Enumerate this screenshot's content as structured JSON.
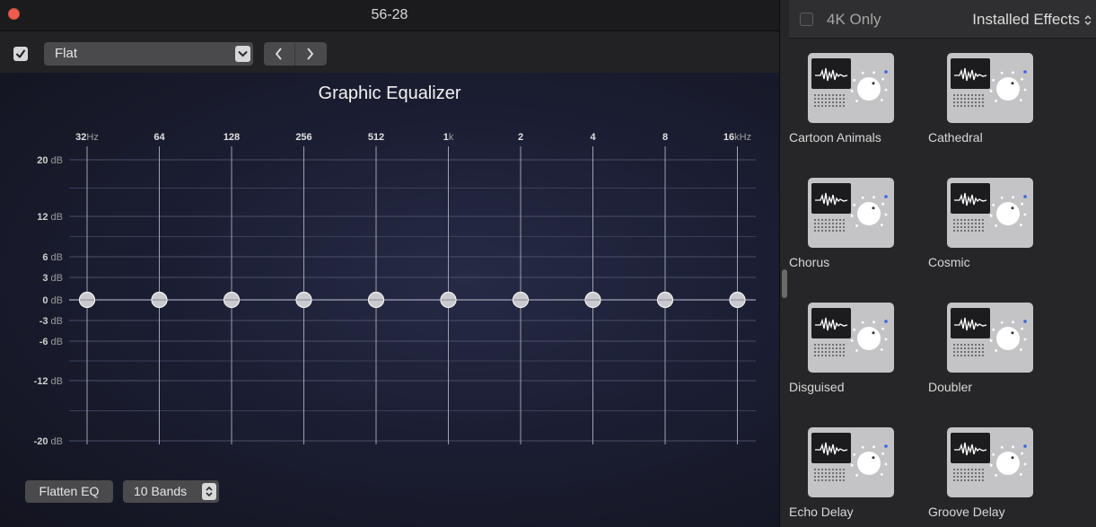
{
  "window": {
    "title": "56-28"
  },
  "toolbar": {
    "enabled": true,
    "preset": "Flat",
    "prev_icon": "chevron-left",
    "next_icon": "chevron-right"
  },
  "eq": {
    "heading": "Graphic Equalizer",
    "band_labels": [
      {
        "main": "32",
        "unit": "Hz"
      },
      {
        "main": "64",
        "unit": ""
      },
      {
        "main": "128",
        "unit": ""
      },
      {
        "main": "256",
        "unit": ""
      },
      {
        "main": "512",
        "unit": ""
      },
      {
        "main": "1",
        "unit": "k"
      },
      {
        "main": "2",
        "unit": ""
      },
      {
        "main": "4",
        "unit": ""
      },
      {
        "main": "8",
        "unit": ""
      },
      {
        "main": "16",
        "unit": "kHz"
      }
    ],
    "db_scale": [
      {
        "value": 20,
        "label": "20 dB"
      },
      {
        "value": 12,
        "label": "12 dB"
      },
      {
        "value": 6,
        "label": "6 dB"
      },
      {
        "value": 3,
        "label": "3 dB"
      },
      {
        "value": 0,
        "label": "0 dB"
      },
      {
        "value": -3,
        "label": "-3 dB"
      },
      {
        "value": -6,
        "label": "-6 dB"
      },
      {
        "value": -12,
        "label": "-12 dB"
      },
      {
        "value": -20,
        "label": "-20 dB"
      }
    ],
    "gains_db": [
      0,
      0,
      0,
      0,
      0,
      0,
      0,
      0,
      0,
      0
    ],
    "flatten_label": "Flatten EQ",
    "bands_label": "10 Bands"
  },
  "effects": {
    "only_4k_label": "4K Only",
    "only_4k_checked": false,
    "category": "Installed Effects",
    "items": [
      "Cartoon Animals",
      "Cathedral",
      "Chorus",
      "Cosmic",
      "Disguised",
      "Doubler",
      "Echo Delay",
      "Groove Delay"
    ]
  },
  "colors": {
    "accent_knob_dot": "#3b63e0",
    "close_button": "#ee5b4f"
  }
}
